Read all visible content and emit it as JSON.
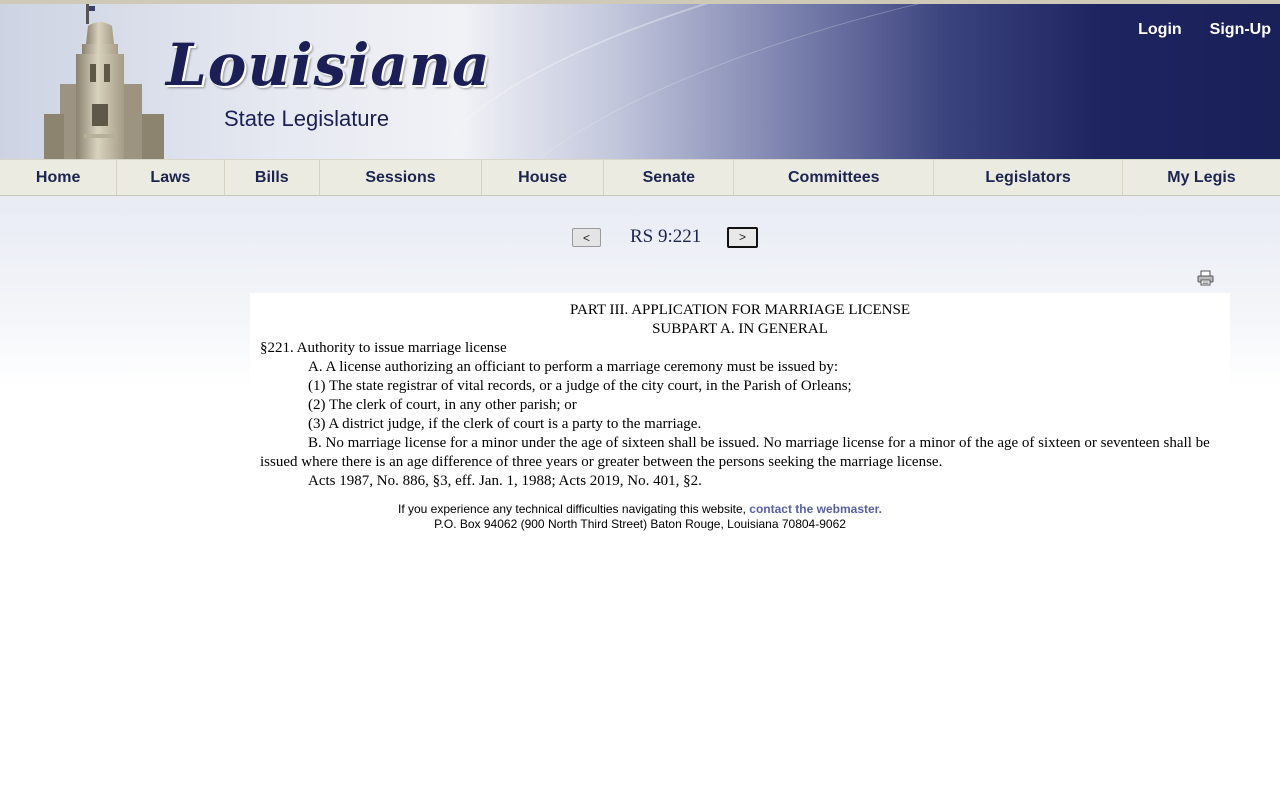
{
  "header": {
    "logo_title": "Louisiana",
    "logo_subtitle": "State Legislature",
    "login_label": "Login",
    "signup_label": "Sign-Up"
  },
  "nav": {
    "items": [
      {
        "label": "Home"
      },
      {
        "label": "Laws"
      },
      {
        "label": "Bills"
      },
      {
        "label": "Sessions"
      },
      {
        "label": "House"
      },
      {
        "label": "Senate"
      },
      {
        "label": "Committees"
      },
      {
        "label": "Legislators"
      },
      {
        "label": "My Legis"
      }
    ]
  },
  "pager": {
    "prev_label": "<",
    "next_label": ">",
    "title": "RS 9:221"
  },
  "document": {
    "part_heading": "PART III. APPLICATION FOR MARRIAGE LICENSE",
    "subpart_heading": "SUBPART A. IN GENERAL",
    "section_title": "§221. Authority to issue marriage license",
    "para_a": "A. A license authorizing an officiant to perform a marriage ceremony must be issued by:",
    "para_a1": "(1) The state registrar of vital records, or a judge of the city court, in the Parish of Orleans;",
    "para_a2": "(2) The clerk of court, in any other parish; or",
    "para_a3": "(3) A district judge, if the clerk of court is a party to the marriage.",
    "para_b": "B. No marriage license for a minor under the age of sixteen shall be issued. No marriage license for a minor of the age of sixteen or seventeen shall be issued where there is an age difference of three years or greater between the persons seeking the marriage license.",
    "history": "Acts 1987, No. 886, §3, eff. Jan. 1, 1988; Acts 2019, No. 401, §2."
  },
  "footer": {
    "line1_text": "If you experience any technical difficulties navigating this website, ",
    "webmaster_link": "contact the webmaster.",
    "line2_text": "P.O. Box 94062 (900 North Third Street) Baton Rouge, Louisiana 70804-9062"
  },
  "icons": {
    "print": "printer-icon"
  },
  "colors": {
    "nav_text": "#1c2450",
    "banner_dark": "#1a2058",
    "link": "#5a5fa0"
  }
}
